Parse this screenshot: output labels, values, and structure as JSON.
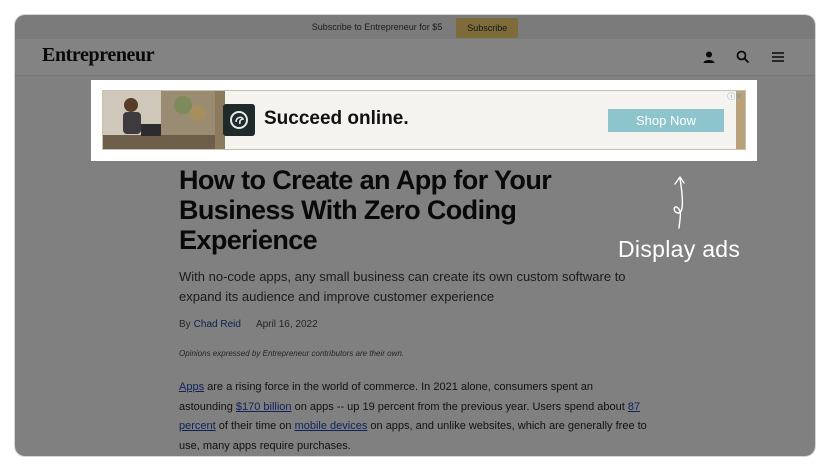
{
  "topbar": {
    "subscribe_text": "Subscribe to Entrepreneur for $5",
    "subscribe_button": "Subscribe"
  },
  "header": {
    "logo": "Entrepreneur",
    "icons": [
      "user-icon",
      "search-icon",
      "menu-icon"
    ]
  },
  "ad": {
    "headline": "Succeed online.",
    "cta": "Shop Now",
    "ad_choices": "ⓘ✕"
  },
  "article": {
    "headline": "How to Create an App for Your Business With Zero Coding Experience",
    "subhead": "With no-code apps, any small business can create its own custom software to expand its audience and improve customer experience",
    "by_prefix": "By",
    "author": "Chad Reid",
    "date": "April 16, 2022",
    "disclaimer": "Opinions expressed by Entrepreneur contributors are their own.",
    "body": {
      "link_apps": "Apps",
      "t1": " are a rising force in the world of commerce. In 2021 alone, consumers spent an astounding ",
      "link_170": "$170 billion",
      "t2": " on apps -- up 19 percent from the previous year. Users spend about ",
      "link_87": "87 percent",
      "t3": " of their time on ",
      "link_mobile": "mobile devices",
      "t4": " on apps, and unlike websites, which are generally free to use, many apps require purchases."
    }
  },
  "annotation": {
    "label": "Display ads"
  },
  "colors": {
    "subscribe_button": "#e6c36a",
    "cta": "#8ec5cc",
    "link": "#1c3fa8"
  }
}
